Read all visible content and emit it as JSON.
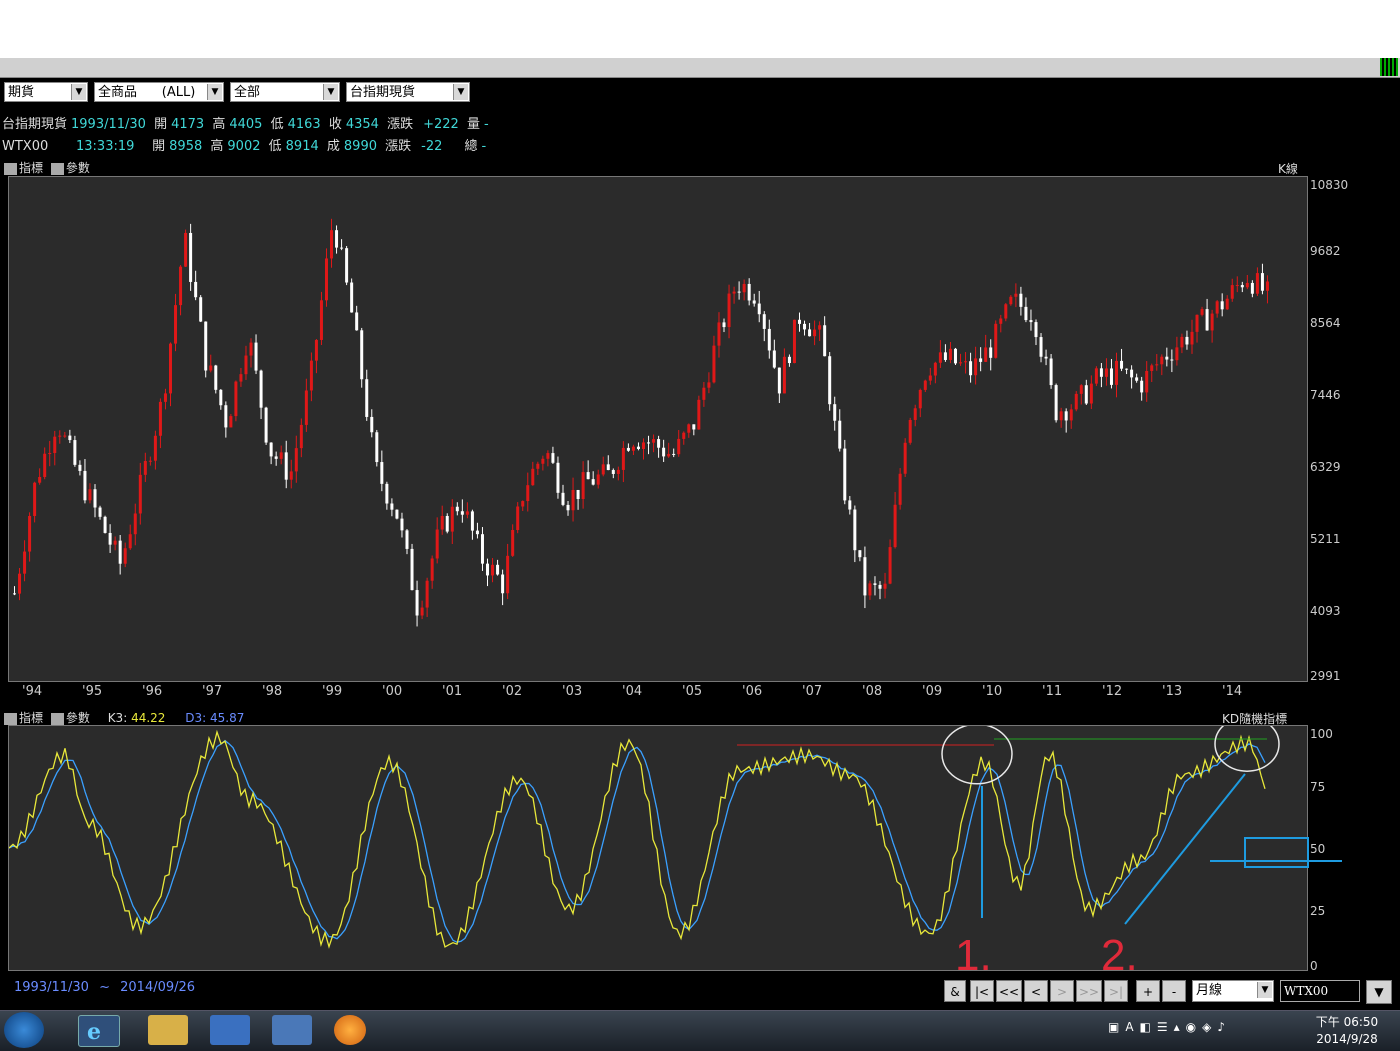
{
  "toolbar": {
    "selects": [
      {
        "value": "期貨"
      },
      {
        "value": "全商品      (ALL)"
      },
      {
        "value": "全部"
      },
      {
        "value": "台指期現貨"
      }
    ]
  },
  "quote1": {
    "name": "台指期現貨",
    "date": "1993/11/30",
    "open_label": "開",
    "open": "4173",
    "high_label": "高",
    "high": "4405",
    "low_label": "低",
    "low": "4163",
    "close_label": "收",
    "close": "4354",
    "chg_label": "漲跌",
    "chg": "+222",
    "vol_label": "量",
    "vol": "-"
  },
  "quote2": {
    "name": "WTX00",
    "time": "13:33:19",
    "open_label": "開",
    "open": "8958",
    "high_label": "高",
    "high": "9002",
    "low_label": "低",
    "low": "8914",
    "close_label": "成",
    "close": "8990",
    "chg_label": "漲跌",
    "chg": "-22",
    "vol_label": "總",
    "vol": "-"
  },
  "panel1": {
    "indicator_label": "指標",
    "param_label": "參數",
    "type_label": "K線"
  },
  "panel2": {
    "indicator_label": "指標",
    "param_label": "參數",
    "k_label": "K3:",
    "k_value": "44.22",
    "d_label": "D3:",
    "d_value": "45.87",
    "type_label": "KD隨機指標"
  },
  "chart_data": [
    {
      "type": "candlestick",
      "title": "",
      "ylim": [
        2991,
        10830
      ],
      "yticks": [
        "10830",
        "9682",
        "8564",
        "7446",
        "6329",
        "5211",
        "4093",
        "2991"
      ],
      "xticks": [
        "'94",
        "'95",
        "'96",
        "'97",
        "'98",
        "'99",
        "'00",
        "'01",
        "'02",
        "'03",
        "'04",
        "'05",
        "'06",
        "'07",
        "'08",
        "'09",
        "'10",
        "'11",
        "'12",
        "'13",
        "'14"
      ],
      "monthly_close": [
        4354,
        6100,
        7050,
        6200,
        5500,
        4800,
        6100,
        7400,
        9900,
        8000,
        7000,
        8400,
        6600,
        6200,
        7800,
        10200,
        8500,
        6300,
        5600,
        4100,
        5300,
        5800,
        4900,
        4500,
        6000,
        6600,
        5800,
        6100,
        6200,
        6800,
        6700,
        6500,
        7000,
        8200,
        9200,
        9000,
        7600,
        8700,
        8300,
        6100,
        4400,
        4400,
        7000,
        7900,
        8000,
        7800,
        8200,
        8900,
        8700,
        7200,
        7300,
        7700,
        7800,
        7600,
        8000,
        8300,
        8600,
        8900,
        9300,
        9000
      ]
    },
    {
      "type": "line",
      "title": "",
      "ylim": [
        0,
        100
      ],
      "yticks": [
        "100",
        "75",
        "50",
        "25",
        "0"
      ],
      "series": [
        {
          "name": "K3",
          "color": "#e8e83a"
        },
        {
          "name": "D3",
          "color": "#3aa0ff"
        }
      ],
      "annotations": [
        "1.",
        "2."
      ]
    }
  ],
  "footer": {
    "range_start": "1993/11/30",
    "range_sep": "~",
    "range_end": "2014/09/26"
  },
  "nav": {
    "amp": "&",
    "first": "|<",
    "prev_fast": "<<",
    "prev": "<",
    "next": ">",
    "next_fast": ">>",
    "last": ">|",
    "zoom_in": "+",
    "zoom_out": "-",
    "period": "月線",
    "symbol": "WTX00"
  },
  "taskbar": {
    "time": "下午 06:50",
    "date": "2014/9/28"
  }
}
